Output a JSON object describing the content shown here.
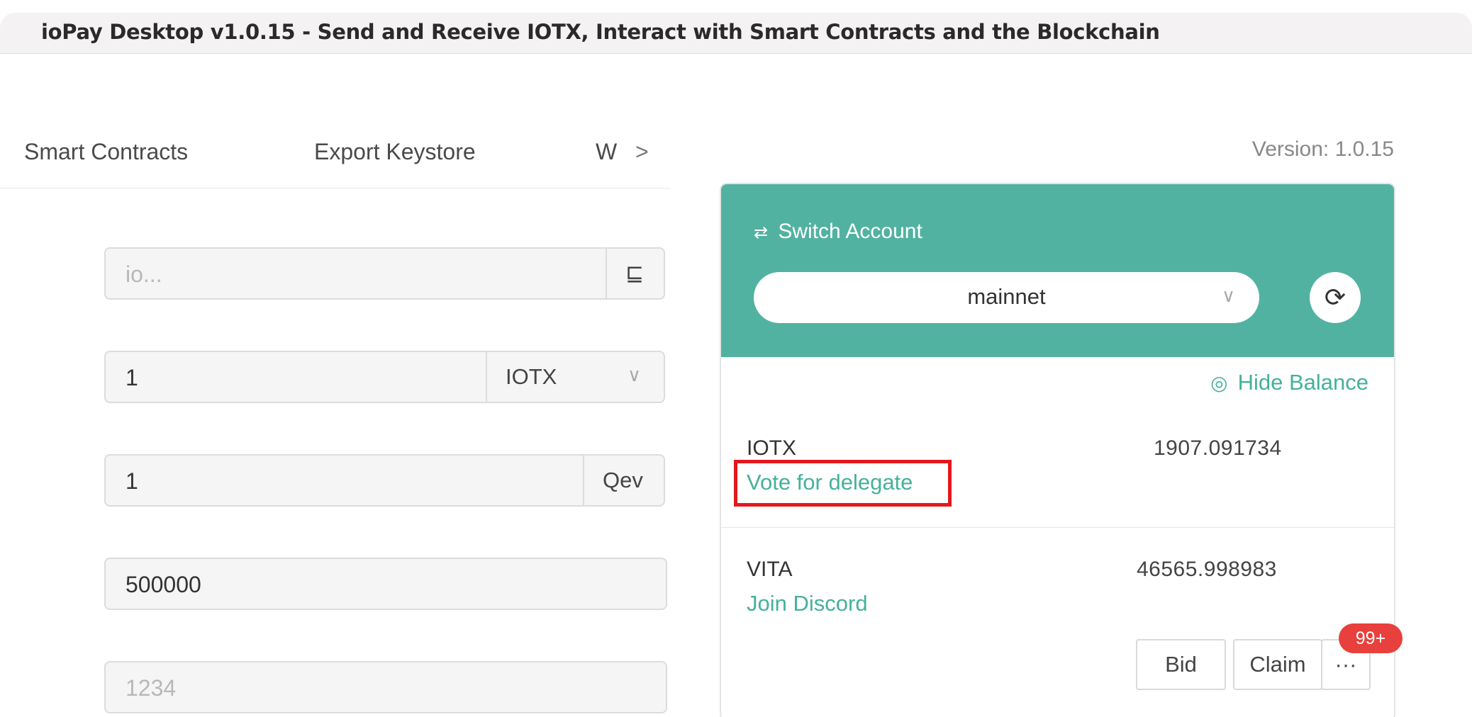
{
  "window": {
    "title": "ioPay Desktop v1.0.15 - Send and Receive IOTX, Interact with Smart Contracts and the Blockchain"
  },
  "tabs": {
    "items": [
      {
        "label": "Smart Contracts"
      },
      {
        "label": "Export Keystore"
      },
      {
        "label": "W"
      }
    ],
    "more_icon": "chevron-right-icon",
    "more_glyph": ">"
  },
  "form": {
    "address": {
      "placeholder": "io...",
      "addon_icon": "wallet-icon",
      "addon_glyph": "⊑"
    },
    "amount": {
      "value": "1",
      "token": "IOTX",
      "token_chevron": "∨"
    },
    "gas_price": {
      "value": "1",
      "unit": "Qev"
    },
    "gas_limit": {
      "value": "500000"
    },
    "nonce": {
      "placeholder": "1234"
    }
  },
  "version": "Version: 1.0.15",
  "account": {
    "switch_label": "Switch Account",
    "switch_glyph": "⇄",
    "network": "mainnet",
    "network_chevron": "∨",
    "refresh_glyph": "⟳",
    "hide_balance": "Hide Balance",
    "hide_icon_glyph": "◎",
    "tokens": [
      {
        "name": "IOTX",
        "amount": "1907.091734",
        "link": "Vote for delegate"
      },
      {
        "name": "VITA",
        "amount": "46565.998983",
        "link": "Join Discord"
      }
    ],
    "actions": {
      "bid": "Bid",
      "claim": "Claim",
      "more": "···",
      "badge": "99+"
    }
  },
  "colors": {
    "accent": "#52b2a1",
    "link": "#45b19b",
    "badge": "#e8403c",
    "highlight": "#e3181c"
  }
}
